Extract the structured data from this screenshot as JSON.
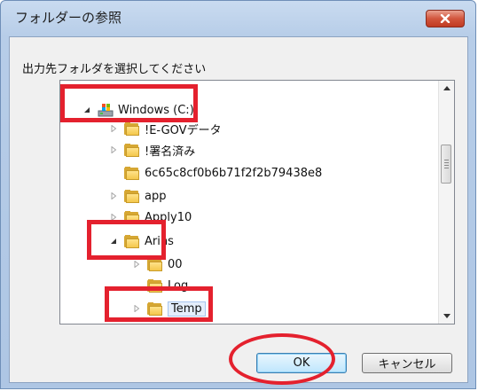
{
  "window": {
    "title": "フォルダーの参照"
  },
  "dialog": {
    "instruction": "出力先フォルダを選択してください",
    "tree": [
      {
        "label": "Windows (C:)",
        "expander": "expanded",
        "kind": "drive"
      },
      {
        "label": "!E-GOVデータ",
        "expander": "collapsed",
        "kind": "folder"
      },
      {
        "label": "!署名済み",
        "expander": "collapsed",
        "kind": "folder"
      },
      {
        "label": "6c65c8cf0b6b71f2f2b79438e8",
        "expander": "none",
        "kind": "folder"
      },
      {
        "label": "app",
        "expander": "collapsed",
        "kind": "folder"
      },
      {
        "label": "Apply10",
        "expander": "collapsed",
        "kind": "folder"
      },
      {
        "label": "Arins",
        "expander": "expanded",
        "kind": "folder"
      },
      {
        "label": "00",
        "expander": "collapsed",
        "kind": "folder"
      },
      {
        "label": "Log",
        "expander": "none",
        "kind": "folder"
      },
      {
        "label": "Temp",
        "expander": "collapsed",
        "kind": "folder",
        "selected": true
      }
    ],
    "ok_label": "OK",
    "cancel_label": "キャンセル"
  },
  "colors": {
    "highlight": "#e4212e",
    "selection": "#e4eefb"
  }
}
